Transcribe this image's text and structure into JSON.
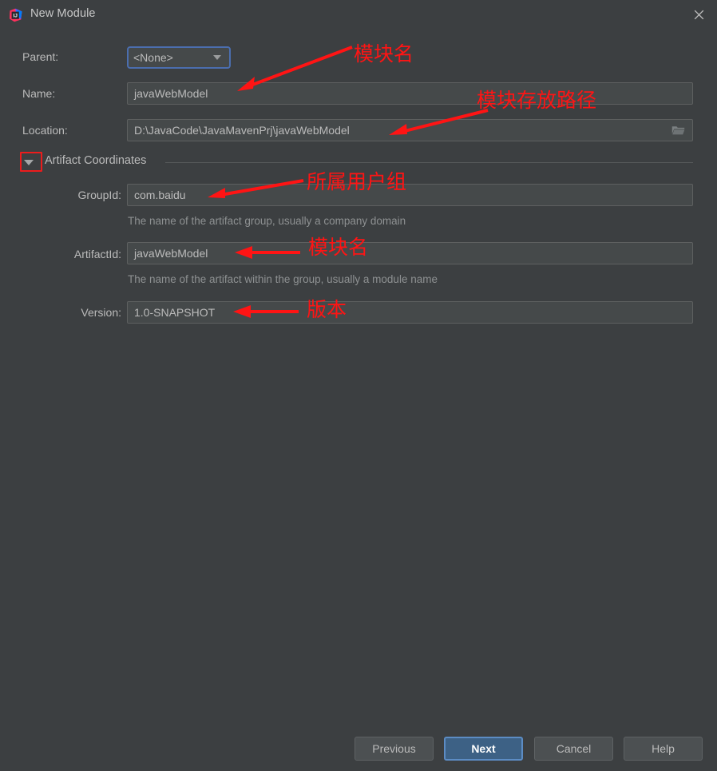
{
  "window": {
    "title": "New Module",
    "app_icon": "intellij-idea-logo-icon",
    "close_icon": "close-icon"
  },
  "form": {
    "parent": {
      "label": "Parent:",
      "value": "<None>",
      "dropdown_icon": "chevron-down-icon"
    },
    "name": {
      "label": "Name:",
      "value": "javaWebModel"
    },
    "location": {
      "label": "Location:",
      "value": "D:\\JavaCode\\JavaMavenPrj\\javaWebModel",
      "browse_icon": "folder-icon"
    },
    "artifact_section": {
      "title": "Artifact Coordinates",
      "collapse_icon": "triangle-down-icon",
      "group_id": {
        "label": "GroupId:",
        "value": "com.baidu",
        "hint": "The name of the artifact group, usually a company domain"
      },
      "artifact_id": {
        "label": "ArtifactId:",
        "value": "javaWebModel",
        "hint": "The name of the artifact within the group, usually a module name"
      },
      "version": {
        "label": "Version:",
        "value": "1.0-SNAPSHOT"
      }
    }
  },
  "buttons": {
    "previous": "Previous",
    "next": "Next",
    "cancel": "Cancel",
    "help": "Help"
  },
  "annotations": {
    "module_name_top": "模块名",
    "module_path": "模块存放路径",
    "user_group": "所属用户组",
    "module_name_artifact": "模块名",
    "version": "版本"
  },
  "colors": {
    "window_bg": "#3c3f41",
    "field_bg": "#45494a",
    "accent_blue": "#4b6eaf",
    "primary_button": "#3d6185",
    "annotation_red": "#ff1414",
    "text": "#bbbbbb",
    "hint_text": "#8e9192"
  }
}
